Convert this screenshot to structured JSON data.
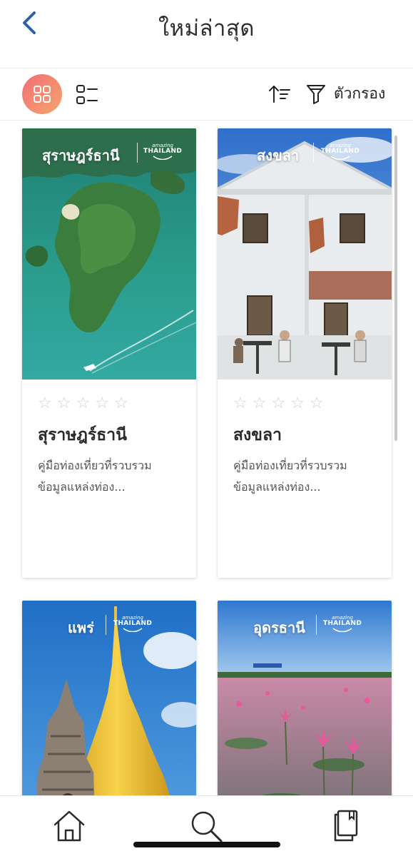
{
  "header": {
    "title": "ใหม่ล่าสุด",
    "back_icon": "chevron-left-icon",
    "accent": "#2f5fa7"
  },
  "toolbar": {
    "grid_view_icon": "grid-icon",
    "list_view_icon": "list-icon",
    "sort_icon": "sort-icon",
    "filter_icon": "filter-icon",
    "filter_label": "ตัวกรอง",
    "active_gradient": [
      "#f26f76",
      "#f4a56c"
    ]
  },
  "cards": [
    {
      "cover_title": "สุราษฎร์ธานี",
      "logo_small": "amazing",
      "logo_big": "THAILAND",
      "rating": 0,
      "max_rating": 5,
      "name": "สุราษฎร์ธานี",
      "desc_line1": "คู่มือท่องเที่ยวที่รวบรวม",
      "desc_line2": "ข้อมูลแหล่งท่อง..."
    },
    {
      "cover_title": "สงขลา",
      "logo_small": "amazing",
      "logo_big": "THAILAND",
      "rating": 0,
      "max_rating": 5,
      "name": "สงขลา",
      "desc_line1": "คู่มือท่องเที่ยวที่รวบรวม",
      "desc_line2": "ข้อมูลแหล่งท่อง..."
    },
    {
      "cover_title": "แพร่",
      "logo_small": "amazing",
      "logo_big": "THAILAND"
    },
    {
      "cover_title": "อุดรธานี",
      "logo_small": "amazing",
      "logo_big": "THAILAND"
    }
  ],
  "bottom_nav": {
    "items": [
      "home-icon",
      "search-icon",
      "book-icon"
    ]
  }
}
